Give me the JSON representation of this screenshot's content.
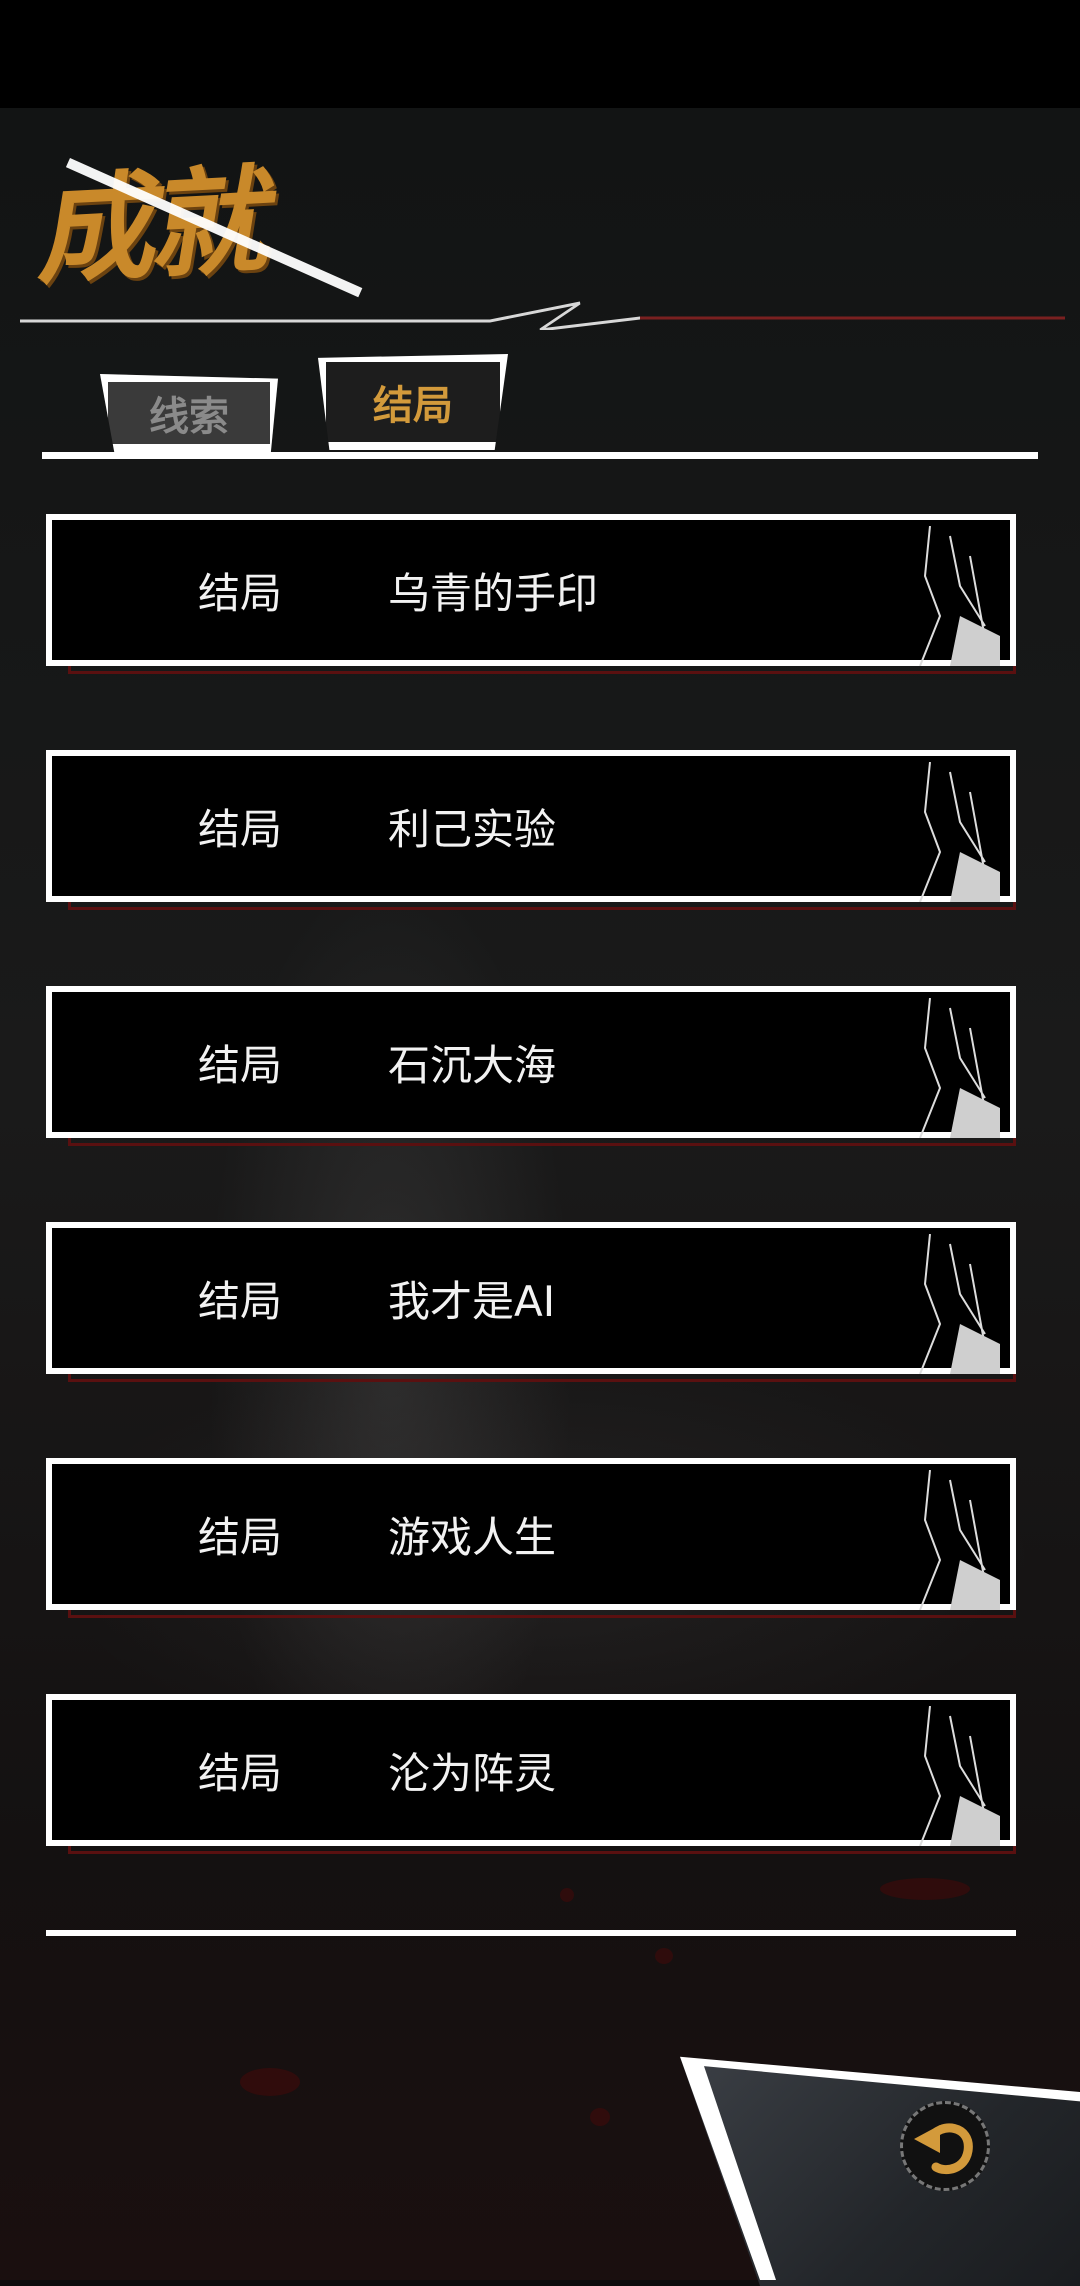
{
  "page": {
    "title": "成就"
  },
  "tabs": [
    {
      "label": "线索",
      "active": false
    },
    {
      "label": "结局",
      "active": true
    }
  ],
  "endings": [
    {
      "label": "结局",
      "name": "乌青的手印"
    },
    {
      "label": "结局",
      "name": "利己实验"
    },
    {
      "label": "结局",
      "name": "石沉大海"
    },
    {
      "label": "结局",
      "name": "我才是AI"
    },
    {
      "label": "结局",
      "name": "游戏人生"
    },
    {
      "label": "结局",
      "name": "沦为阵灵"
    }
  ],
  "colors": {
    "accent_gold": "#c9892a",
    "card_shadow_red": "#5a1010",
    "background": "#121212"
  },
  "icons": {
    "back": "back-arrow-icon"
  }
}
